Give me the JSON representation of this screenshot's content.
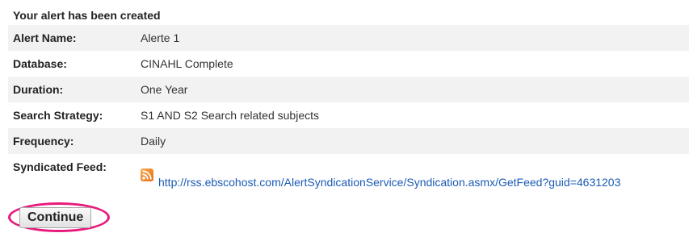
{
  "heading": "Your alert has been created",
  "rows": [
    {
      "label": "Alert Name:",
      "value": "Alerte 1"
    },
    {
      "label": "Database:",
      "value": "CINAHL Complete"
    },
    {
      "label": "Duration:",
      "value": "One Year"
    },
    {
      "label": "Search Strategy:",
      "value": "S1 AND S2 Search related subjects"
    },
    {
      "label": "Frequency:",
      "value": "Daily"
    }
  ],
  "feed": {
    "label": "Syndicated Feed:",
    "url": "http://rss.ebscohost.com/AlertSyndicationService/Syndication.asmx/GetFeed?guid=4631203",
    "icon": "rss-icon"
  },
  "continue_label": "Continue",
  "colors": {
    "highlight": "#e8197d",
    "link": "#1a5bb5",
    "row_alt_bg": "#f2f2f2"
  }
}
